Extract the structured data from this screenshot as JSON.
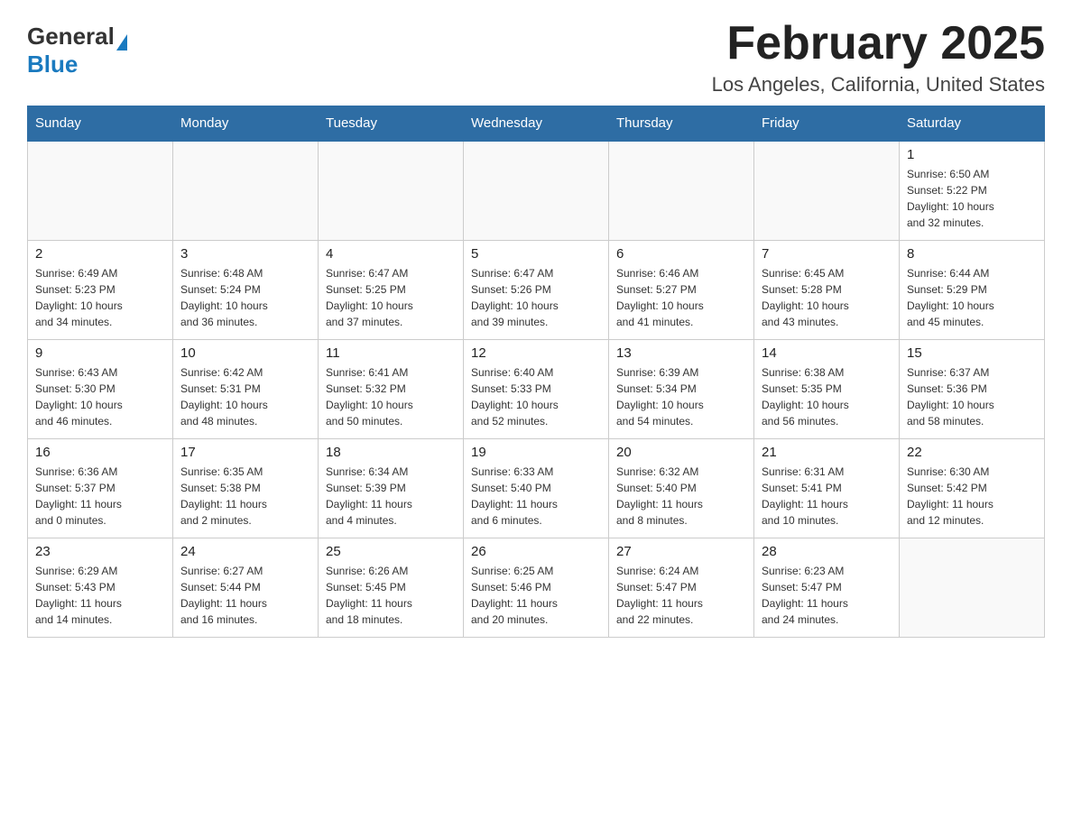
{
  "header": {
    "logo_general": "General",
    "logo_blue": "Blue",
    "title": "February 2025",
    "subtitle": "Los Angeles, California, United States"
  },
  "days_of_week": [
    "Sunday",
    "Monday",
    "Tuesday",
    "Wednesday",
    "Thursday",
    "Friday",
    "Saturday"
  ],
  "weeks": [
    {
      "days": [
        {
          "number": "",
          "info": ""
        },
        {
          "number": "",
          "info": ""
        },
        {
          "number": "",
          "info": ""
        },
        {
          "number": "",
          "info": ""
        },
        {
          "number": "",
          "info": ""
        },
        {
          "number": "",
          "info": ""
        },
        {
          "number": "1",
          "info": "Sunrise: 6:50 AM\nSunset: 5:22 PM\nDaylight: 10 hours\nand 32 minutes."
        }
      ]
    },
    {
      "days": [
        {
          "number": "2",
          "info": "Sunrise: 6:49 AM\nSunset: 5:23 PM\nDaylight: 10 hours\nand 34 minutes."
        },
        {
          "number": "3",
          "info": "Sunrise: 6:48 AM\nSunset: 5:24 PM\nDaylight: 10 hours\nand 36 minutes."
        },
        {
          "number": "4",
          "info": "Sunrise: 6:47 AM\nSunset: 5:25 PM\nDaylight: 10 hours\nand 37 minutes."
        },
        {
          "number": "5",
          "info": "Sunrise: 6:47 AM\nSunset: 5:26 PM\nDaylight: 10 hours\nand 39 minutes."
        },
        {
          "number": "6",
          "info": "Sunrise: 6:46 AM\nSunset: 5:27 PM\nDaylight: 10 hours\nand 41 minutes."
        },
        {
          "number": "7",
          "info": "Sunrise: 6:45 AM\nSunset: 5:28 PM\nDaylight: 10 hours\nand 43 minutes."
        },
        {
          "number": "8",
          "info": "Sunrise: 6:44 AM\nSunset: 5:29 PM\nDaylight: 10 hours\nand 45 minutes."
        }
      ]
    },
    {
      "days": [
        {
          "number": "9",
          "info": "Sunrise: 6:43 AM\nSunset: 5:30 PM\nDaylight: 10 hours\nand 46 minutes."
        },
        {
          "number": "10",
          "info": "Sunrise: 6:42 AM\nSunset: 5:31 PM\nDaylight: 10 hours\nand 48 minutes."
        },
        {
          "number": "11",
          "info": "Sunrise: 6:41 AM\nSunset: 5:32 PM\nDaylight: 10 hours\nand 50 minutes."
        },
        {
          "number": "12",
          "info": "Sunrise: 6:40 AM\nSunset: 5:33 PM\nDaylight: 10 hours\nand 52 minutes."
        },
        {
          "number": "13",
          "info": "Sunrise: 6:39 AM\nSunset: 5:34 PM\nDaylight: 10 hours\nand 54 minutes."
        },
        {
          "number": "14",
          "info": "Sunrise: 6:38 AM\nSunset: 5:35 PM\nDaylight: 10 hours\nand 56 minutes."
        },
        {
          "number": "15",
          "info": "Sunrise: 6:37 AM\nSunset: 5:36 PM\nDaylight: 10 hours\nand 58 minutes."
        }
      ]
    },
    {
      "days": [
        {
          "number": "16",
          "info": "Sunrise: 6:36 AM\nSunset: 5:37 PM\nDaylight: 11 hours\nand 0 minutes."
        },
        {
          "number": "17",
          "info": "Sunrise: 6:35 AM\nSunset: 5:38 PM\nDaylight: 11 hours\nand 2 minutes."
        },
        {
          "number": "18",
          "info": "Sunrise: 6:34 AM\nSunset: 5:39 PM\nDaylight: 11 hours\nand 4 minutes."
        },
        {
          "number": "19",
          "info": "Sunrise: 6:33 AM\nSunset: 5:40 PM\nDaylight: 11 hours\nand 6 minutes."
        },
        {
          "number": "20",
          "info": "Sunrise: 6:32 AM\nSunset: 5:40 PM\nDaylight: 11 hours\nand 8 minutes."
        },
        {
          "number": "21",
          "info": "Sunrise: 6:31 AM\nSunset: 5:41 PM\nDaylight: 11 hours\nand 10 minutes."
        },
        {
          "number": "22",
          "info": "Sunrise: 6:30 AM\nSunset: 5:42 PM\nDaylight: 11 hours\nand 12 minutes."
        }
      ]
    },
    {
      "days": [
        {
          "number": "23",
          "info": "Sunrise: 6:29 AM\nSunset: 5:43 PM\nDaylight: 11 hours\nand 14 minutes."
        },
        {
          "number": "24",
          "info": "Sunrise: 6:27 AM\nSunset: 5:44 PM\nDaylight: 11 hours\nand 16 minutes."
        },
        {
          "number": "25",
          "info": "Sunrise: 6:26 AM\nSunset: 5:45 PM\nDaylight: 11 hours\nand 18 minutes."
        },
        {
          "number": "26",
          "info": "Sunrise: 6:25 AM\nSunset: 5:46 PM\nDaylight: 11 hours\nand 20 minutes."
        },
        {
          "number": "27",
          "info": "Sunrise: 6:24 AM\nSunset: 5:47 PM\nDaylight: 11 hours\nand 22 minutes."
        },
        {
          "number": "28",
          "info": "Sunrise: 6:23 AM\nSunset: 5:47 PM\nDaylight: 11 hours\nand 24 minutes."
        },
        {
          "number": "",
          "info": ""
        }
      ]
    }
  ]
}
